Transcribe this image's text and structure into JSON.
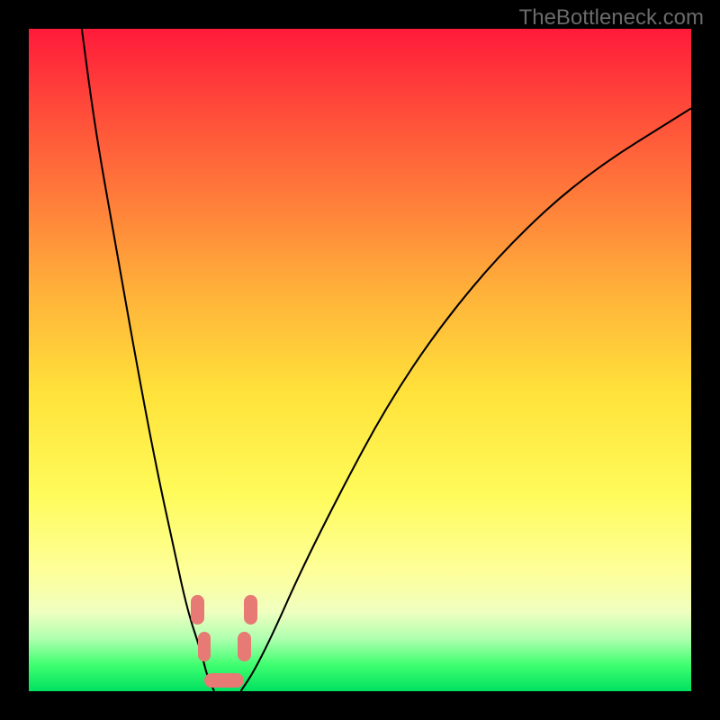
{
  "watermark": "TheBottleneck.com",
  "chart_data": {
    "type": "line",
    "title": "",
    "xlabel": "",
    "ylabel": "",
    "xlim": [
      0,
      100
    ],
    "ylim": [
      0,
      100
    ],
    "gradient_stops": [
      {
        "pct": 0,
        "color": "#ff1a3a"
      },
      {
        "pct": 12,
        "color": "#ff4a3a"
      },
      {
        "pct": 25,
        "color": "#ff7a3a"
      },
      {
        "pct": 40,
        "color": "#ffb23a"
      },
      {
        "pct": 55,
        "color": "#ffe23a"
      },
      {
        "pct": 70,
        "color": "#fffb5a"
      },
      {
        "pct": 82,
        "color": "#feff9a"
      },
      {
        "pct": 88,
        "color": "#f0ffc0"
      },
      {
        "pct": 92,
        "color": "#b0ffb0"
      },
      {
        "pct": 96,
        "color": "#40ff70"
      },
      {
        "pct": 100,
        "color": "#00e060"
      }
    ],
    "series": [
      {
        "name": "left-curve",
        "x": [
          8,
          10,
          13,
          16,
          19,
          22,
          24,
          26,
          27,
          28
        ],
        "y": [
          100,
          85,
          68,
          51,
          35,
          21,
          12,
          6,
          2,
          0
        ]
      },
      {
        "name": "right-curve",
        "x": [
          32,
          34,
          37,
          41,
          47,
          54,
          62,
          72,
          84,
          100
        ],
        "y": [
          0,
          3,
          9,
          18,
          30,
          43,
          55,
          67,
          78,
          88
        ]
      }
    ],
    "markers": [
      {
        "name": "left-tick-upper",
        "x": 25.5,
        "y": 10,
        "w": 2.0,
        "h": 4.5
      },
      {
        "name": "left-tick-lower",
        "x": 26.5,
        "y": 4.5,
        "w": 2.0,
        "h": 4.5
      },
      {
        "name": "right-tick-upper",
        "x": 33.5,
        "y": 10,
        "w": 2.0,
        "h": 4.5
      },
      {
        "name": "right-tick-lower",
        "x": 32.5,
        "y": 4.5,
        "w": 2.0,
        "h": 4.5
      },
      {
        "name": "bottom-bar",
        "x": 29.5,
        "y": 0.5,
        "w": 6.0,
        "h": 2.2
      }
    ],
    "curve_color": "#000000",
    "marker_color": "#e77a74"
  }
}
